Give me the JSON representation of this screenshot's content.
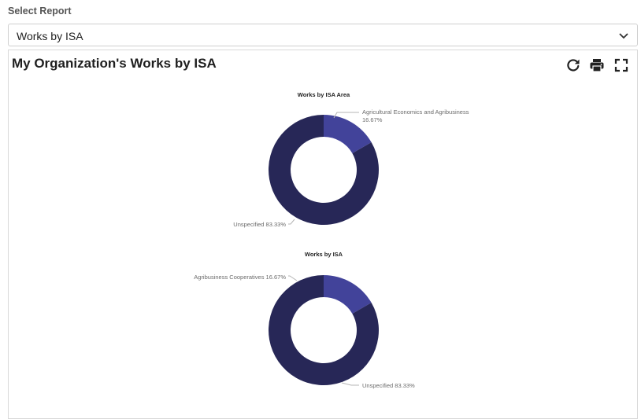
{
  "select": {
    "label": "Select Report",
    "value": "Works by ISA"
  },
  "panel": {
    "title": "My Organization's Works by ISA"
  },
  "toolbar": {
    "refresh_icon": "refresh-icon",
    "print_icon": "print-icon",
    "fullscreen_icon": "fullscreen-icon"
  },
  "colors": {
    "dark_segment": "#272757",
    "light_segment": "#42439a",
    "leader_line": "#b5b5b5",
    "label_text": "#6b6b6b"
  },
  "chart_data": [
    {
      "type": "pie",
      "donut": true,
      "title": "Works by ISA Area",
      "slices": [
        {
          "label": "Agricultural Economics and Agribusiness",
          "value": 16.67,
          "value_label": "16.67%",
          "color": "#42439a"
        },
        {
          "label": "Unspecified",
          "value": 83.33,
          "value_label": "83.33%",
          "color": "#272757"
        }
      ]
    },
    {
      "type": "pie",
      "donut": true,
      "title": "Works by ISA",
      "slices": [
        {
          "label": "Agribusiness Cooperatives",
          "value": 16.67,
          "value_label": "16.67%",
          "color": "#42439a"
        },
        {
          "label": "Unspecified",
          "value": 83.33,
          "value_label": "83.33%",
          "color": "#272757"
        }
      ]
    }
  ]
}
